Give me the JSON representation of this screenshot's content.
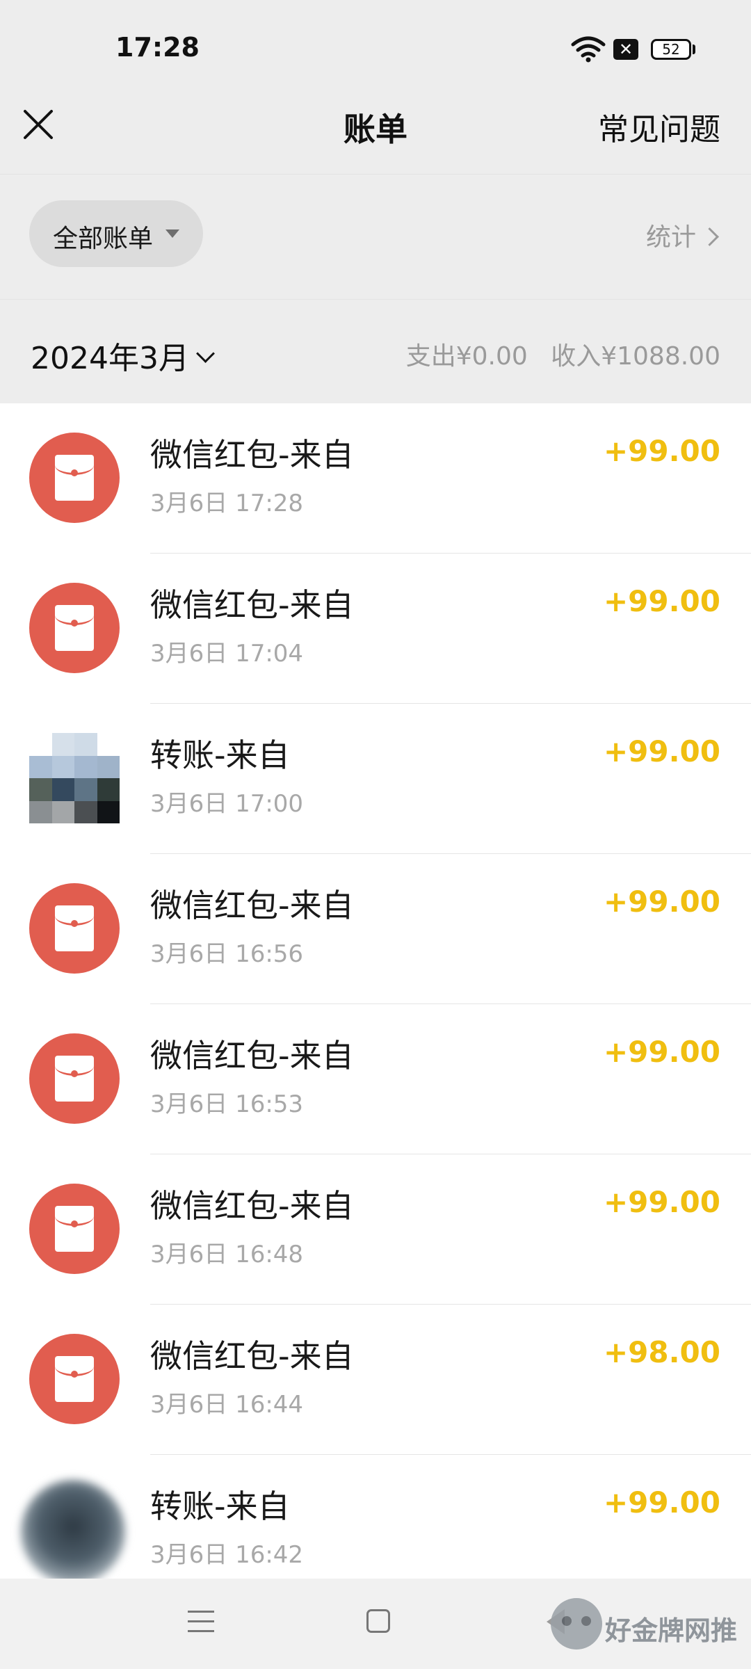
{
  "status_bar": {
    "time": "17:28",
    "battery": "52"
  },
  "header": {
    "title": "账单",
    "faq_label": "常见问题"
  },
  "filter": {
    "label": "全部账单",
    "stats_label": "统计"
  },
  "month": {
    "label": "2024年3月",
    "expense": "支出¥0.00",
    "income": "收入¥1088.00"
  },
  "transactions": [
    {
      "title": "微信红包-来自",
      "time": "3月6日 17:28",
      "amount": "+99.00",
      "icon": "red-packet-icon"
    },
    {
      "title": "微信红包-来自",
      "time": "3月6日 17:04",
      "amount": "+99.00",
      "icon": "red-packet-icon"
    },
    {
      "title": "转账-来自",
      "time": "3月6日 17:00",
      "amount": "+99.00",
      "icon": "avatar"
    },
    {
      "title": "微信红包-来自",
      "time": "3月6日 16:56",
      "amount": "+99.00",
      "icon": "red-packet-icon"
    },
    {
      "title": "微信红包-来自",
      "time": "3月6日 16:53",
      "amount": "+99.00",
      "icon": "red-packet-icon"
    },
    {
      "title": "微信红包-来自",
      "time": "3月6日 16:48",
      "amount": "+99.00",
      "icon": "red-packet-icon"
    },
    {
      "title": "微信红包-来自",
      "time": "3月6日 16:44",
      "amount": "+98.00",
      "icon": "red-packet-icon"
    },
    {
      "title": "转账-来自",
      "time": "3月6日 16:42",
      "amount": "+99.00",
      "icon": "avatar"
    }
  ],
  "watermark": "好金牌网推",
  "colors": {
    "amount": "#f0be10",
    "red_packet": "#e15d4f",
    "background": "#ededed"
  }
}
